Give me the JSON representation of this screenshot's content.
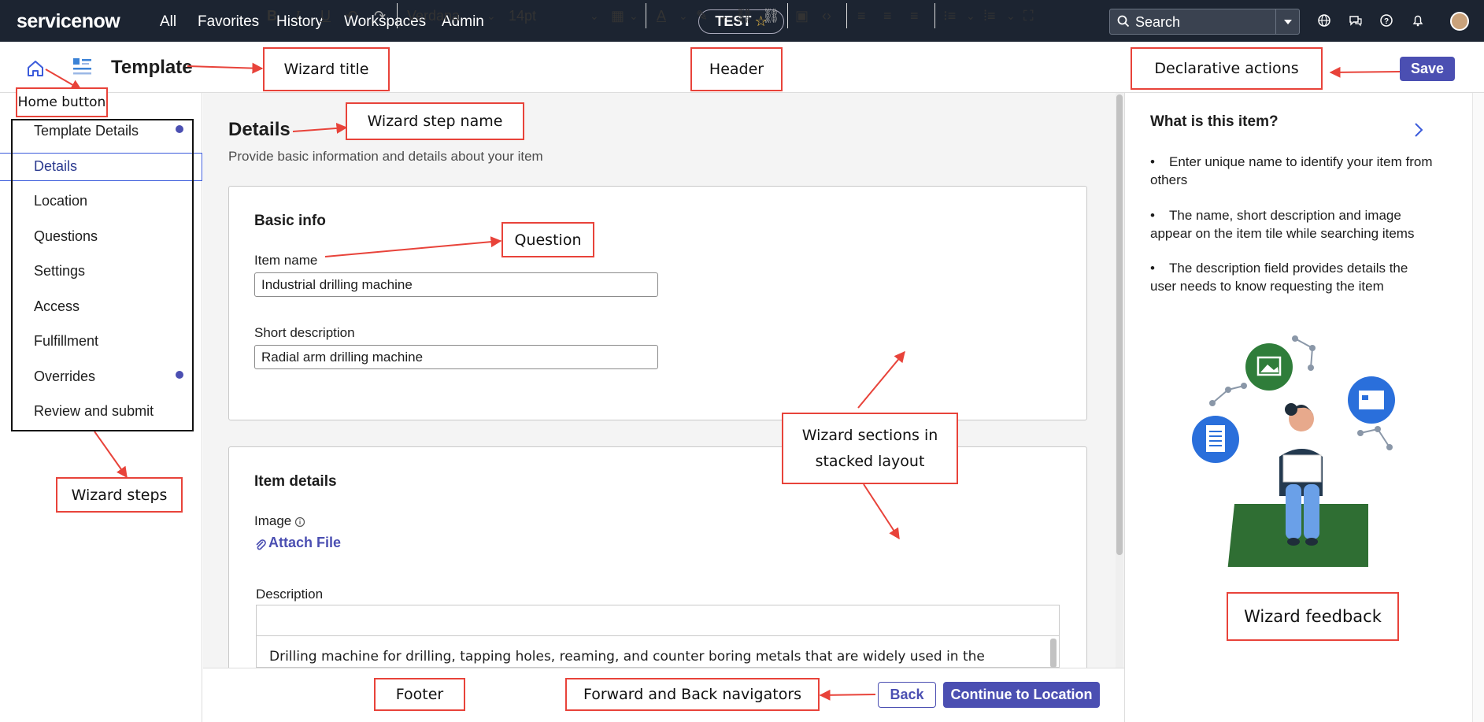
{
  "topnav": {
    "logo": "servicenow",
    "links": [
      "All",
      "Favorites",
      "History",
      "Workspaces",
      "Admin"
    ],
    "instance": "TEST",
    "search_placeholder": "Search"
  },
  "header": {
    "title": "Template",
    "save_label": "Save"
  },
  "sidebar": {
    "steps": [
      {
        "label": "Template Details",
        "dot": true
      },
      {
        "label": "Details",
        "selected": true
      },
      {
        "label": "Location"
      },
      {
        "label": "Questions"
      },
      {
        "label": "Settings"
      },
      {
        "label": "Access"
      },
      {
        "label": "Fulfillment"
      },
      {
        "label": "Overrides",
        "dot": true
      },
      {
        "label": "Review and submit"
      }
    ]
  },
  "main": {
    "step_name": "Details",
    "step_desc": "Provide basic information and details about your item",
    "basic_info": {
      "title": "Basic info",
      "item_name_label": "Item name",
      "item_name_value": "Industrial drilling machine",
      "short_desc_label": "Short description",
      "short_desc_value": "Radial arm drilling machine"
    },
    "item_details": {
      "title": "Item details",
      "image_label": "Image",
      "attach_label": "Attach File",
      "description_label": "Description",
      "font_family": "Verdana",
      "font_size": "14pt",
      "description_text": "Drilling machine for drilling, tapping holes, reaming, and counter boring metals that are widely used in the"
    }
  },
  "footer": {
    "back_label": "Back",
    "continue_label": "Continue to Location"
  },
  "feedback": {
    "title": "What is this item?",
    "items": [
      "Enter unique name to identify your item from others",
      "The name, short description and image appear on the item tile while searching items",
      "The description field provides details the user needs to know requesting the item"
    ]
  },
  "annotations": {
    "home_button": "Home button",
    "wizard_title": "Wizard title",
    "header": "Header",
    "declarative_actions": "Declarative actions",
    "wizard_step_name": "Wizard step name",
    "question": "Question",
    "wizard_sections_line1": "Wizard sections in",
    "wizard_sections_line2": "stacked layout",
    "wizard_steps": "Wizard steps",
    "wizard_feedback": "Wizard feedback",
    "footer": "Footer",
    "forward_back": "Forward and Back navigators"
  },
  "colors": {
    "nav_bg": "#1c2431",
    "accent": "#4b4fb2",
    "annotation": "#e8433a",
    "main_bg": "#f4f4f4"
  }
}
